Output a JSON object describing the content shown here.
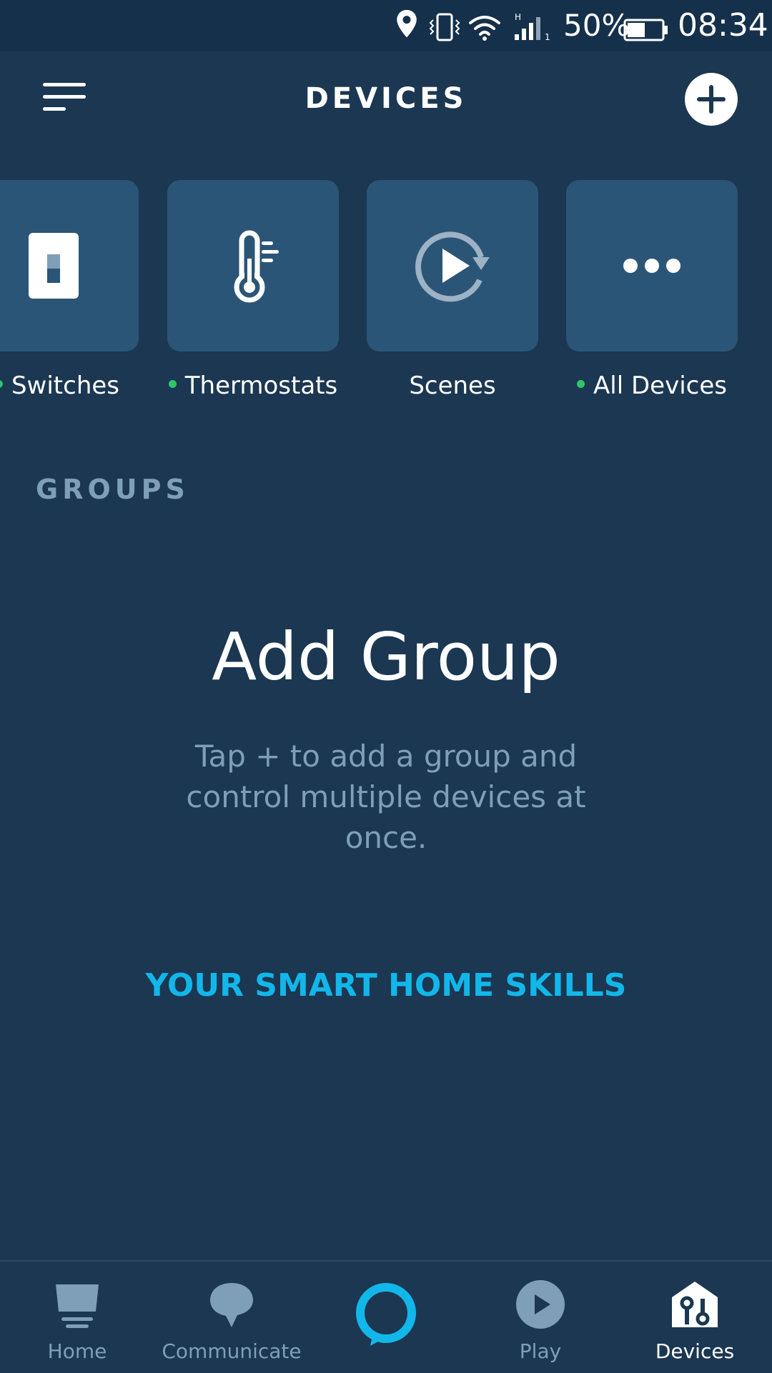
{
  "status_bar": {
    "battery_percent": "50%",
    "time": "08:34",
    "icons": [
      "location-icon",
      "vibrate-icon",
      "wifi-icon",
      "cell-signal-icon",
      "battery-icon"
    ]
  },
  "header": {
    "title": "DEVICES",
    "menu_icon": "hamburger-menu-icon",
    "add_icon": "plus-icon"
  },
  "categories": [
    {
      "label": "Switches",
      "icon": "switch-icon",
      "has_dot": true
    },
    {
      "label": "Thermostats",
      "icon": "thermometer-icon",
      "has_dot": true
    },
    {
      "label": "Scenes",
      "icon": "scene-play-icon",
      "has_dot": false
    },
    {
      "label": "All Devices",
      "icon": "more-dots-icon",
      "has_dot": true
    }
  ],
  "groups": {
    "heading": "GROUPS",
    "empty_title": "Add Group",
    "empty_description": "Tap + to add a group and control multiple devices at once."
  },
  "skills_link": "YOUR SMART HOME SKILLS",
  "bottom_nav": {
    "items": [
      {
        "label": "Home",
        "icon": "home-icon",
        "active": false
      },
      {
        "label": "Communicate",
        "icon": "speech-bubble-icon",
        "active": false
      },
      {
        "label": "",
        "icon": "alexa-ring-icon",
        "active": false
      },
      {
        "label": "Play",
        "icon": "play-icon",
        "active": false
      },
      {
        "label": "Devices",
        "icon": "devices-house-icon",
        "active": true
      }
    ]
  },
  "colors": {
    "background": "#1b3752",
    "status_bar": "#15304a",
    "tile": "#2b5577",
    "accent": "#12b7ea",
    "muted_text": "#7f9fb8",
    "online_dot": "#2ec56b"
  }
}
